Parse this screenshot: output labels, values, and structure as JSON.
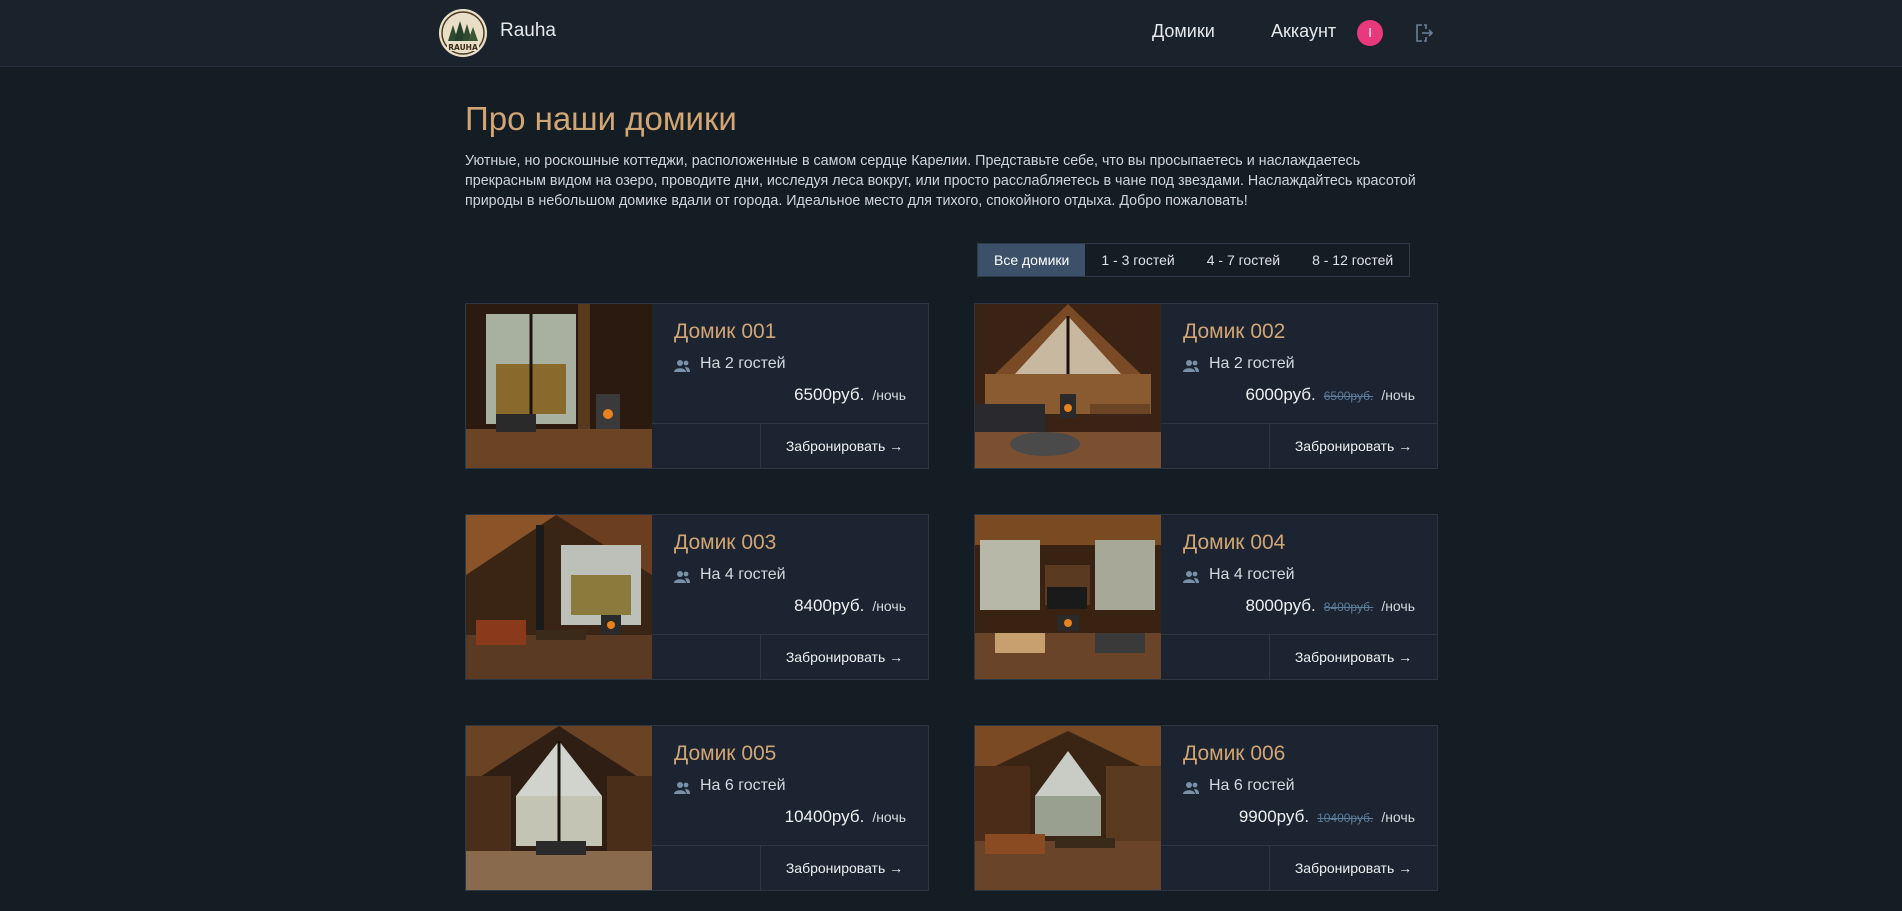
{
  "header": {
    "brand": "Rauha",
    "logo_text": "RAUHA",
    "nav_cabins": "Домики",
    "nav_account": "Аккаунт",
    "avatar_initial": "I",
    "logout_icon": "logout-icon"
  },
  "main": {
    "title": "Про наши домики",
    "description": "Уютные, но роскошные коттеджи, расположенные в самом сердце Карелии. Представьте себе, что вы просыпаетесь и наслаждаетесь прекрасным видом на озеро, проводите дни, исследуя леса вокруг, или просто расслабляетесь в чане под звездами. Наслаждайтесь красотой природы в небольшом домике вдали от города. Идеальное место для тихого, спокойного отдыха. Добро пожаловать!"
  },
  "filters": [
    {
      "label": "Все домики",
      "active": true
    },
    {
      "label": "1 - 3 гостей",
      "active": false
    },
    {
      "label": "4 - 7 гостей",
      "active": false
    },
    {
      "label": "8 - 12 гостей",
      "active": false
    }
  ],
  "cabins": [
    {
      "name": "Домик 001",
      "guests": "На 2 гостей",
      "price": "6500руб.",
      "old_price": "",
      "per_night": "/ночь",
      "book": "Забронировать →"
    },
    {
      "name": "Домик 002",
      "guests": "На 2 гостей",
      "price": "6000руб.",
      "old_price": "6500руб.",
      "per_night": "/ночь",
      "book": "Забронировать →"
    },
    {
      "name": "Домик 003",
      "guests": "На 4 гостей",
      "price": "8400руб.",
      "old_price": "",
      "per_night": "/ночь",
      "book": "Забронировать →"
    },
    {
      "name": "Домик 004",
      "guests": "На 4 гостей",
      "price": "8000руб.",
      "old_price": "8400руб.",
      "per_night": "/ночь",
      "book": "Забронировать →"
    },
    {
      "name": "Домик 005",
      "guests": "На 6 гостей",
      "price": "10400руб.",
      "old_price": "",
      "per_night": "/ночь",
      "book": "Забронировать →"
    },
    {
      "name": "Домик 006",
      "guests": "На 6 гостей",
      "price": "9900руб.",
      "old_price": "10400руб.",
      "per_night": "/ночь",
      "book": "Забронировать →"
    }
  ],
  "colors": {
    "background": "#141c24",
    "accent": "#d1a574",
    "active_filter": "#3c5069",
    "avatar": "#e8397c"
  }
}
